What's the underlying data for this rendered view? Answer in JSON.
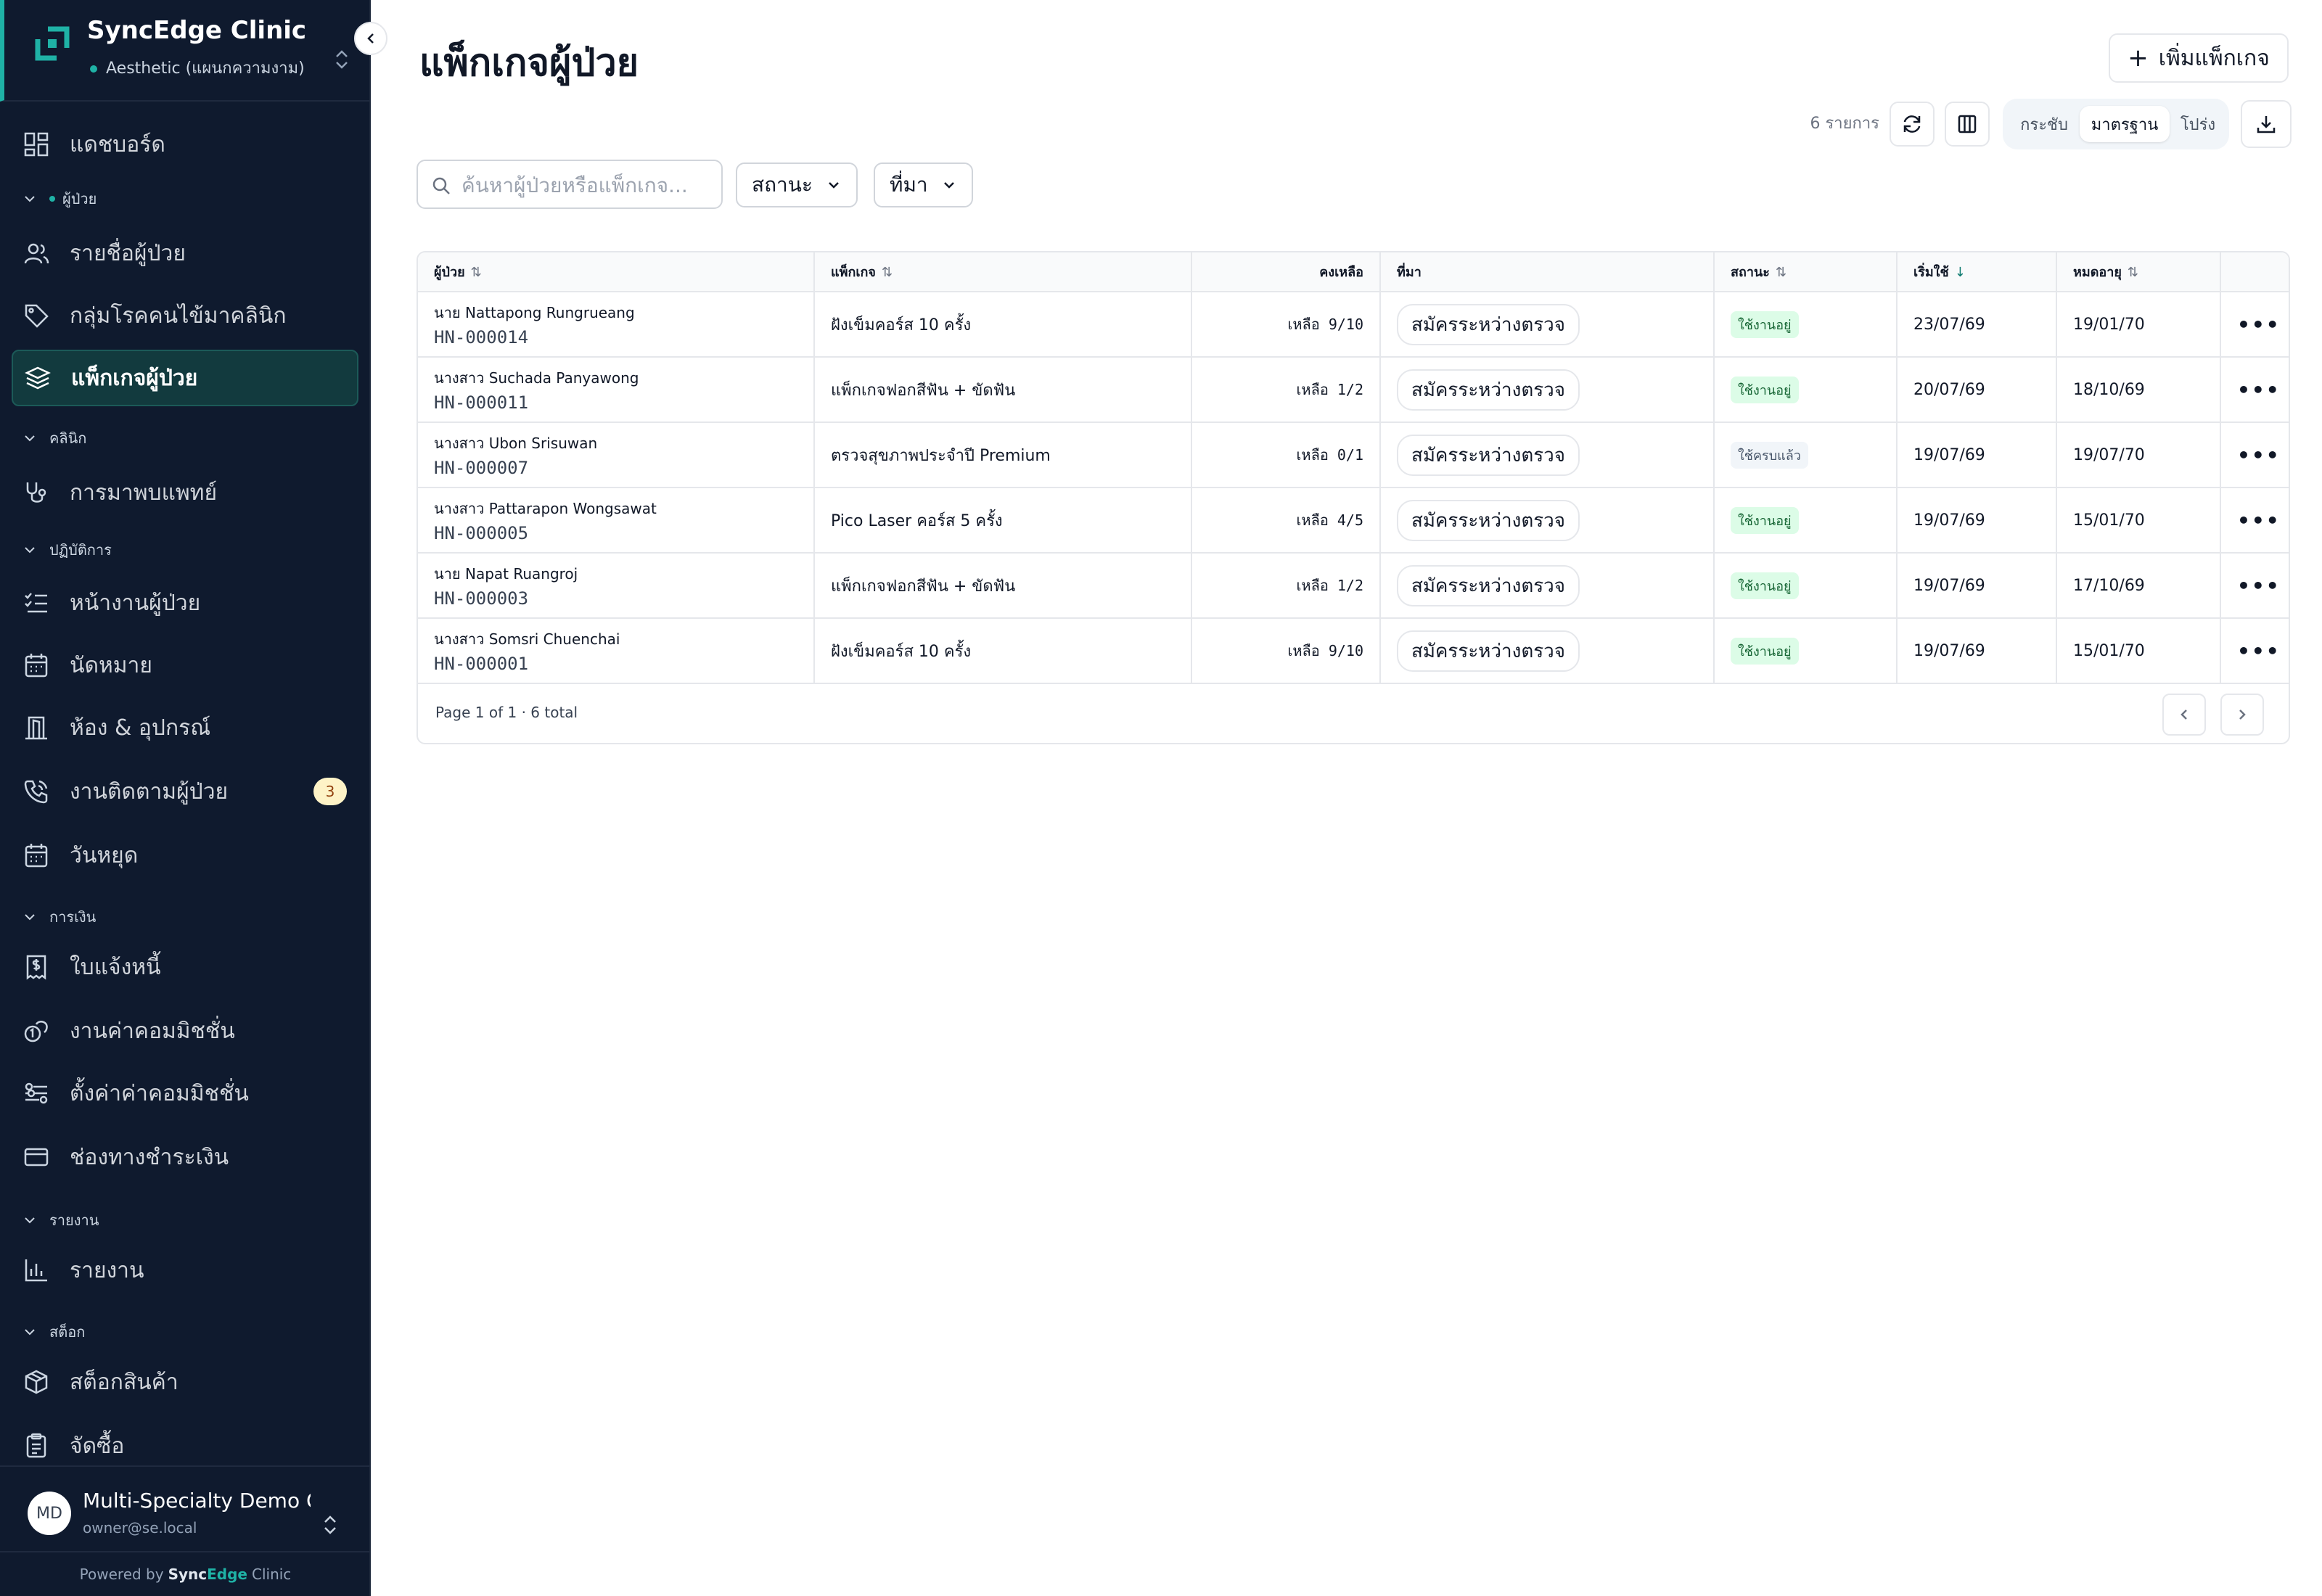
{
  "brand": {
    "title": "SyncEdge Clinic",
    "subtitle": "Aesthetic (แผนกความงาม)",
    "accent": "#1fb2a6"
  },
  "sidebar": {
    "dashboard": "แดชบอร์ด",
    "sections": {
      "patients": "ผู้ป่วย",
      "clinic": "คลินิก",
      "operations": "ปฏิบัติการ",
      "finance": "การเงิน",
      "reports": "รายงาน",
      "stock": "สต็อก"
    },
    "items": {
      "patient_list": "รายชื่อผู้ป่วย",
      "chronic_group": "กลุ่มโรคคนไข้มาคลินิก",
      "patient_packages": "แพ็กเกจผู้ป่วย",
      "doctor_visit": "การมาพบแพทย์",
      "patient_tasks": "หน้างานผู้ป่วย",
      "appointments": "นัดหมาย",
      "rooms": "ห้อง & อุปกรณ์",
      "followups": "งานติดตามผู้ป่วย",
      "followups_badge": "3",
      "holidays": "วันหยุด",
      "invoices": "ใบแจ้งหนี้",
      "commission_jobs": "งานค่าคอมมิชชั่น",
      "commission_settings": "ตั้งค่าค่าคอมมิชชั่น",
      "payment_channels": "ช่องทางชำระเงิน",
      "reports": "รายงาน",
      "stock_items": "สต็อกสินค้า",
      "purchasing": "จัดซื้อ"
    },
    "user": {
      "initials": "MD",
      "name": "Multi-Specialty Demo Owner",
      "email": "owner@se.local"
    },
    "powered": {
      "prefix": "Powered by",
      "brand_a": "Sync",
      "brand_b": "Edge",
      "brand_c": "Clinic"
    }
  },
  "page": {
    "title": "แพ็กเกจผู้ป่วย",
    "add_label": "เพิ่มแพ็กเกจ",
    "count_text": "6 รายการ",
    "density": [
      "กระชับ",
      "มาตรฐาน",
      "โปร่ง"
    ],
    "density_selected": "มาตรฐาน",
    "search_placeholder": "ค้นหาผู้ป่วยหรือแพ็กเกจ...",
    "filter_status": "สถานะ",
    "filter_source": "ที่มา"
  },
  "table": {
    "columns": [
      "ผู้ป่วย",
      "แพ็กเกจ",
      "คงเหลือ",
      "ที่มา",
      "สถานะ",
      "เริ่มใช้",
      "หมดอายุ"
    ],
    "rows": [
      {
        "name": "นาย Nattapong Rungrueang",
        "hn": "HN-000014",
        "package": "ฝังเข็มคอร์ส 10 ครั้ง",
        "remain": "เหลือ 9/10",
        "source": "สมัครระหว่างตรวจ",
        "status": "ใช้งานอยู่",
        "status_type": "active",
        "start": "23/07/69",
        "expire": "19/01/70"
      },
      {
        "name": "นางสาว Suchada Panyawong",
        "hn": "HN-000011",
        "package": "แพ็กเกจฟอกสีฟัน + ขัดฟัน",
        "remain": "เหลือ 1/2",
        "source": "สมัครระหว่างตรวจ",
        "status": "ใช้งานอยู่",
        "status_type": "active",
        "start": "20/07/69",
        "expire": "18/10/69"
      },
      {
        "name": "นางสาว Ubon Srisuwan",
        "hn": "HN-000007",
        "package": "ตรวจสุขภาพประจำปี Premium",
        "remain": "เหลือ 0/1",
        "source": "สมัครระหว่างตรวจ",
        "status": "ใช้ครบแล้ว",
        "status_type": "done",
        "start": "19/07/69",
        "expire": "19/07/70"
      },
      {
        "name": "นางสาว Pattarapon Wongsawat",
        "hn": "HN-000005",
        "package": "Pico Laser คอร์ส 5 ครั้ง",
        "remain": "เหลือ 4/5",
        "source": "สมัครระหว่างตรวจ",
        "status": "ใช้งานอยู่",
        "status_type": "active",
        "start": "19/07/69",
        "expire": "15/01/70"
      },
      {
        "name": "นาย Napat Ruangroj",
        "hn": "HN-000003",
        "package": "แพ็กเกจฟอกสีฟัน + ขัดฟัน",
        "remain": "เหลือ 1/2",
        "source": "สมัครระหว่างตรวจ",
        "status": "ใช้งานอยู่",
        "status_type": "active",
        "start": "19/07/69",
        "expire": "17/10/69"
      },
      {
        "name": "นางสาว Somsri Chuenchai",
        "hn": "HN-000001",
        "package": "ฝังเข็มคอร์ส 10 ครั้ง",
        "remain": "เหลือ 9/10",
        "source": "สมัครระหว่างตรวจ",
        "status": "ใช้งานอยู่",
        "status_type": "active",
        "start": "19/07/69",
        "expire": "15/01/70"
      }
    ],
    "page_info": "Page 1 of 1 · 6 total"
  }
}
